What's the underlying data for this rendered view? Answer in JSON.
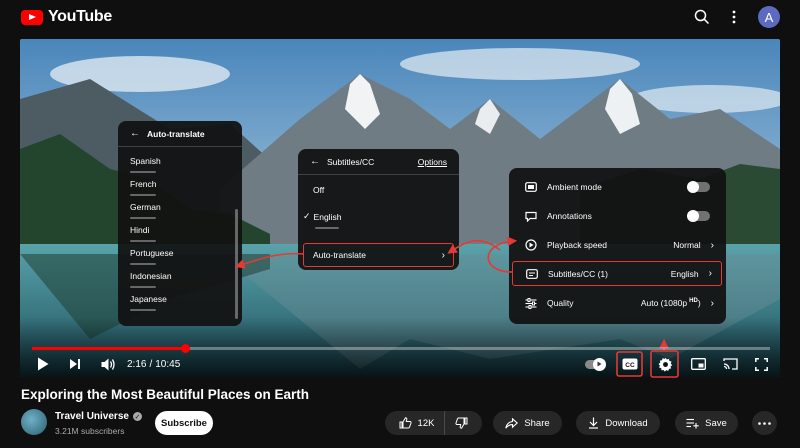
{
  "app": {
    "name": "YouTube",
    "avatar_initial": "A"
  },
  "player": {
    "progress": 0.207,
    "time_current": "2:16",
    "time_separator": "/",
    "time_total": "10:45"
  },
  "settings_menu": {
    "items": [
      {
        "label": "Ambient mode",
        "icon": "ambient-icon",
        "toggle": false
      },
      {
        "label": "Annotations",
        "icon": "annotations-icon",
        "toggle": false
      },
      {
        "label": "Playback speed",
        "icon": "speed-icon",
        "value": "Normal"
      },
      {
        "label": "Subtitles/CC (1)",
        "icon": "cc-icon",
        "value": "English"
      },
      {
        "label": "Quality",
        "icon": "quality-icon",
        "value": "Auto (1080p",
        "badge": "HD",
        "value_suffix": ")"
      }
    ]
  },
  "subtitles_menu": {
    "title": "Subtitles/CC",
    "options_label": "Options",
    "items": [
      {
        "label": "Off"
      },
      {
        "label": "English",
        "selected": true
      },
      {
        "label": "Auto-translate"
      }
    ]
  },
  "autotranslate_menu": {
    "title": "Auto-translate",
    "languages": [
      "Spanish",
      "French",
      "German",
      "Hindi",
      "Portuguese",
      "Indonesian",
      "Japanese"
    ]
  },
  "video": {
    "title": "Exploring the Most Beautiful Places on Earth",
    "channel": "Travel Universe",
    "subscribers": "3.21M subscribers",
    "subscribe_label": "Subscribe",
    "likes": "12K",
    "share_label": "Share",
    "download_label": "Download",
    "save_label": "Save"
  },
  "colors": {
    "accent": "#ff0000",
    "highlight": "#e53935",
    "background": "#0f0f0f"
  }
}
